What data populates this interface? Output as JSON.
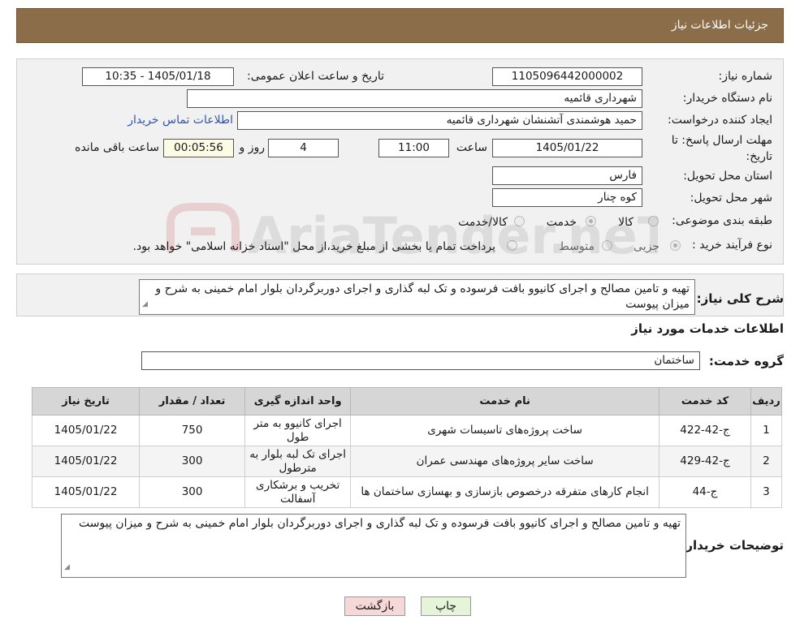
{
  "header": {
    "title": "جزئیات اطلاعات نیاز"
  },
  "form": {
    "need_number_label": "شماره نیاز:",
    "need_number": "1105096442000002",
    "announce_label": "تاریخ و ساعت اعلان عمومی:",
    "announce_value": "1405/01/18 - 10:35",
    "buyer_org_label": "نام دستگاه خریدار:",
    "buyer_org": "شهرداری قائمیه",
    "creator_label": "ایجاد کننده درخواست:",
    "creator": "حمید هوشمندی آتشنشان شهرداری قائمیه",
    "contact_link": "اطلاعات تماس خریدار",
    "deadline_label_1": "مهلت ارسال پاسخ: تا",
    "deadline_label_2": "تاریخ:",
    "deadline_date": "1405/01/22",
    "time_label": "ساعت",
    "deadline_time": "11:00",
    "days_value": "4",
    "days_label": "روز و",
    "remaining_time": "00:05:56",
    "remaining_label": "ساعت باقی مانده",
    "province_label": "استان محل تحویل:",
    "province": "فارس",
    "city_label": "شهر محل تحویل:",
    "city": "کوه چنار",
    "category_label": "طبقه بندی موضوعی:",
    "category_options": [
      "کالا",
      "خدمت",
      "کالا/خدمت"
    ],
    "purchase_type_label": "نوع فرآیند خرید :",
    "purchase_options": [
      "جزیی",
      "متوسط"
    ],
    "purchase_note": "پرداخت تمام یا بخشی از مبلغ خرید،از محل \"اسناد خزانه اسلامی\" خواهد بود."
  },
  "summary": {
    "label": "شرح کلی نیاز:",
    "text": "تهیه و تامین مصالح و اجرای کانیوو بافت فرسوده و تک لبه گذاری و اجرای دوربرگردان بلوار امام خمینی به شرح و میزان پیوست"
  },
  "services": {
    "title": "اطلاعات خدمات مورد نیاز",
    "group_label": "گروه خدمت:",
    "group_value": "ساختمان",
    "columns": [
      "ردیف",
      "کد خدمت",
      "نام خدمت",
      "واحد اندازه گیری",
      "تعداد / مقدار",
      "تاریخ نیاز"
    ],
    "rows": [
      {
        "row": "1",
        "code": "ج-42-422",
        "name": "ساخت پروژه‌های تاسیسات شهری",
        "unit": "اجرای کانیوو به متر طول",
        "qty": "750",
        "date": "1405/01/22"
      },
      {
        "row": "2",
        "code": "ج-42-429",
        "name": "ساخت سایر پروژه‌های مهندسی عمران",
        "unit": "اجرای تک لبه بلوار به مترطول",
        "qty": "300",
        "date": "1405/01/22"
      },
      {
        "row": "3",
        "code": "ج-44",
        "name": "انجام کارهای متفرقه درخصوص بازسازی و بهسازی ساختمان ها",
        "unit": "تخریب و برشکاری آسفالت",
        "qty": "300",
        "date": "1405/01/22"
      }
    ]
  },
  "buyer_notes": {
    "label": "توضیحات خریدار:",
    "text": "تهیه و تامین مصالح و اجرای کانیوو بافت فرسوده و تک لبه گذاری و اجرای دوربرگردان بلوار امام خمینی به شرح و میزان پیوست"
  },
  "buttons": {
    "print": "چاپ",
    "back": "بازگشت"
  },
  "colors": {
    "header": "#8c6d49",
    "print_button": "#e6f4d9",
    "back_button": "#f6d8d8",
    "link": "#2c56b8"
  }
}
